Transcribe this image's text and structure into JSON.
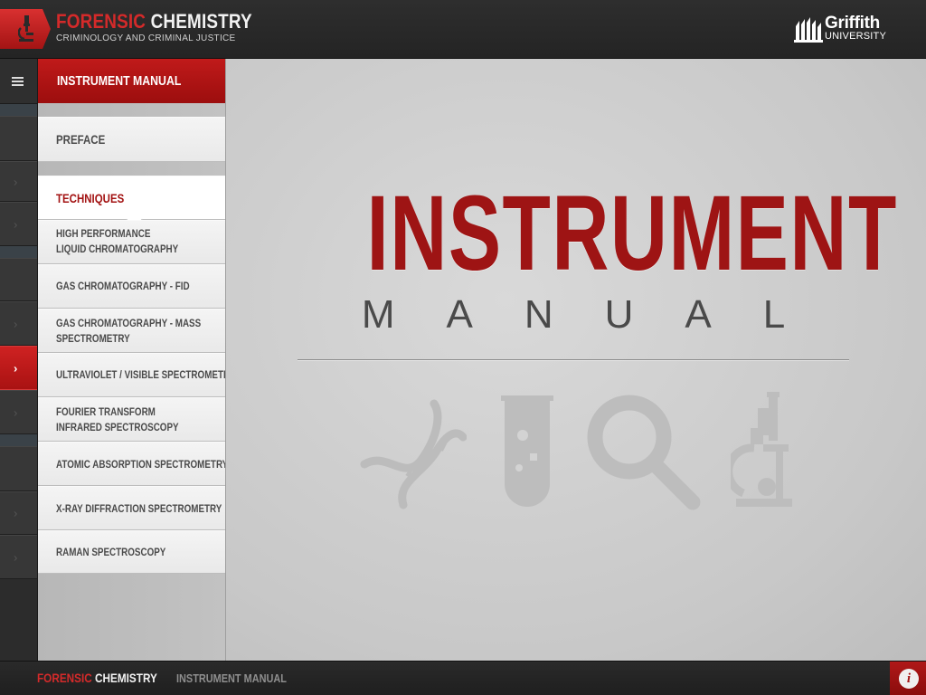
{
  "header": {
    "brand_part1": "FORENSIC",
    "brand_part2": "CHEMISTRY",
    "subtitle": "CRIMINOLOGY AND CRIMINAL JUSTICE",
    "logo_icon": "microscope-icon",
    "university_name": "Griffith",
    "university_sub": "UNIVERSITY"
  },
  "rail": {
    "menu_icon": "hamburger-icon",
    "chevron": "›"
  },
  "panel": {
    "title": "INSTRUMENT MANUAL",
    "items": [
      {
        "label": "PREFACE",
        "type": "section"
      },
      {
        "label": "TECHNIQUES",
        "type": "section",
        "selected": true
      },
      {
        "label_line1": "HIGH PERFORMANCE",
        "label_line2": "LIQUID CHROMATOGRAPHY"
      },
      {
        "label": "GAS CHROMATOGRAPHY - FID"
      },
      {
        "label_line1": "GAS CHROMATOGRAPHY - MASS",
        "label_line2": "SPECTROMETRY"
      },
      {
        "label": "ULTRAVIOLET / VISIBLE SPECTROMETRY"
      },
      {
        "label_line1": "FOURIER TRANSFORM",
        "label_line2": "INFRARED SPECTROSCOPY"
      },
      {
        "label": "ATOMIC ABSORPTION SPECTROMETRY"
      },
      {
        "label": "X-RAY DIFFRACTION SPECTROMETRY"
      },
      {
        "label": "RAMAN SPECTROSCOPY"
      }
    ]
  },
  "main": {
    "title": "INSTRUMENT",
    "subtitle": "MANUAL",
    "icons": [
      "dna-icon",
      "test-tube-icon",
      "magnifier-icon",
      "microscope-icon"
    ]
  },
  "footer": {
    "brand_part1": "FORENSIC",
    "brand_part2": "CHEMISTRY",
    "breadcrumb": "INSTRUMENT MANUAL",
    "info_label": "i"
  },
  "colors": {
    "accent_red": "#a31313",
    "bright_red": "#d42a2a",
    "dark_bg": "#2b2b2b",
    "panel_bg": "#f0f0f0",
    "main_bg": "#d2d2d2"
  }
}
